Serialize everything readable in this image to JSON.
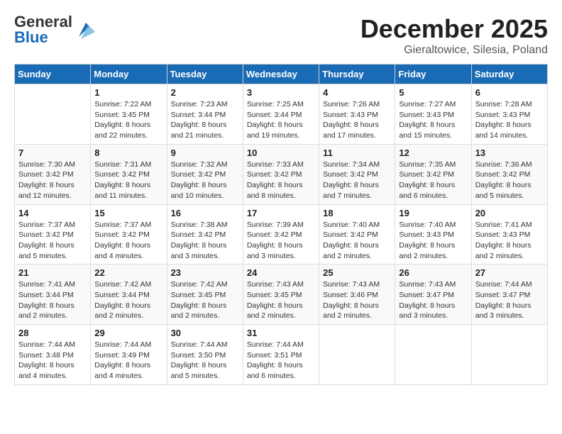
{
  "header": {
    "logo": {
      "general": "General",
      "blue": "Blue"
    },
    "title": "December 2025",
    "location": "Gieraltowice, Silesia, Poland"
  },
  "calendar": {
    "days_of_week": [
      "Sunday",
      "Monday",
      "Tuesday",
      "Wednesday",
      "Thursday",
      "Friday",
      "Saturday"
    ],
    "weeks": [
      [
        {
          "day": null,
          "info": null
        },
        {
          "day": "1",
          "sunrise": "7:22 AM",
          "sunset": "3:45 PM",
          "daylight": "8 hours and 22 minutes."
        },
        {
          "day": "2",
          "sunrise": "7:23 AM",
          "sunset": "3:44 PM",
          "daylight": "8 hours and 21 minutes."
        },
        {
          "day": "3",
          "sunrise": "7:25 AM",
          "sunset": "3:44 PM",
          "daylight": "8 hours and 19 minutes."
        },
        {
          "day": "4",
          "sunrise": "7:26 AM",
          "sunset": "3:43 PM",
          "daylight": "8 hours and 17 minutes."
        },
        {
          "day": "5",
          "sunrise": "7:27 AM",
          "sunset": "3:43 PM",
          "daylight": "8 hours and 15 minutes."
        },
        {
          "day": "6",
          "sunrise": "7:28 AM",
          "sunset": "3:43 PM",
          "daylight": "8 hours and 14 minutes."
        }
      ],
      [
        {
          "day": "7",
          "sunrise": "7:30 AM",
          "sunset": "3:42 PM",
          "daylight": "8 hours and 12 minutes."
        },
        {
          "day": "8",
          "sunrise": "7:31 AM",
          "sunset": "3:42 PM",
          "daylight": "8 hours and 11 minutes."
        },
        {
          "day": "9",
          "sunrise": "7:32 AM",
          "sunset": "3:42 PM",
          "daylight": "8 hours and 10 minutes."
        },
        {
          "day": "10",
          "sunrise": "7:33 AM",
          "sunset": "3:42 PM",
          "daylight": "8 hours and 8 minutes."
        },
        {
          "day": "11",
          "sunrise": "7:34 AM",
          "sunset": "3:42 PM",
          "daylight": "8 hours and 7 minutes."
        },
        {
          "day": "12",
          "sunrise": "7:35 AM",
          "sunset": "3:42 PM",
          "daylight": "8 hours and 6 minutes."
        },
        {
          "day": "13",
          "sunrise": "7:36 AM",
          "sunset": "3:42 PM",
          "daylight": "8 hours and 5 minutes."
        }
      ],
      [
        {
          "day": "14",
          "sunrise": "7:37 AM",
          "sunset": "3:42 PM",
          "daylight": "8 hours and 5 minutes."
        },
        {
          "day": "15",
          "sunrise": "7:37 AM",
          "sunset": "3:42 PM",
          "daylight": "8 hours and 4 minutes."
        },
        {
          "day": "16",
          "sunrise": "7:38 AM",
          "sunset": "3:42 PM",
          "daylight": "8 hours and 3 minutes."
        },
        {
          "day": "17",
          "sunrise": "7:39 AM",
          "sunset": "3:42 PM",
          "daylight": "8 hours and 3 minutes."
        },
        {
          "day": "18",
          "sunrise": "7:40 AM",
          "sunset": "3:42 PM",
          "daylight": "8 hours and 2 minutes."
        },
        {
          "day": "19",
          "sunrise": "7:40 AM",
          "sunset": "3:43 PM",
          "daylight": "8 hours and 2 minutes."
        },
        {
          "day": "20",
          "sunrise": "7:41 AM",
          "sunset": "3:43 PM",
          "daylight": "8 hours and 2 minutes."
        }
      ],
      [
        {
          "day": "21",
          "sunrise": "7:41 AM",
          "sunset": "3:44 PM",
          "daylight": "8 hours and 2 minutes."
        },
        {
          "day": "22",
          "sunrise": "7:42 AM",
          "sunset": "3:44 PM",
          "daylight": "8 hours and 2 minutes."
        },
        {
          "day": "23",
          "sunrise": "7:42 AM",
          "sunset": "3:45 PM",
          "daylight": "8 hours and 2 minutes."
        },
        {
          "day": "24",
          "sunrise": "7:43 AM",
          "sunset": "3:45 PM",
          "daylight": "8 hours and 2 minutes."
        },
        {
          "day": "25",
          "sunrise": "7:43 AM",
          "sunset": "3:46 PM",
          "daylight": "8 hours and 2 minutes."
        },
        {
          "day": "26",
          "sunrise": "7:43 AM",
          "sunset": "3:47 PM",
          "daylight": "8 hours and 3 minutes."
        },
        {
          "day": "27",
          "sunrise": "7:44 AM",
          "sunset": "3:47 PM",
          "daylight": "8 hours and 3 minutes."
        }
      ],
      [
        {
          "day": "28",
          "sunrise": "7:44 AM",
          "sunset": "3:48 PM",
          "daylight": "8 hours and 4 minutes."
        },
        {
          "day": "29",
          "sunrise": "7:44 AM",
          "sunset": "3:49 PM",
          "daylight": "8 hours and 4 minutes."
        },
        {
          "day": "30",
          "sunrise": "7:44 AM",
          "sunset": "3:50 PM",
          "daylight": "8 hours and 5 minutes."
        },
        {
          "day": "31",
          "sunrise": "7:44 AM",
          "sunset": "3:51 PM",
          "daylight": "8 hours and 6 minutes."
        },
        null,
        null,
        null
      ]
    ]
  }
}
